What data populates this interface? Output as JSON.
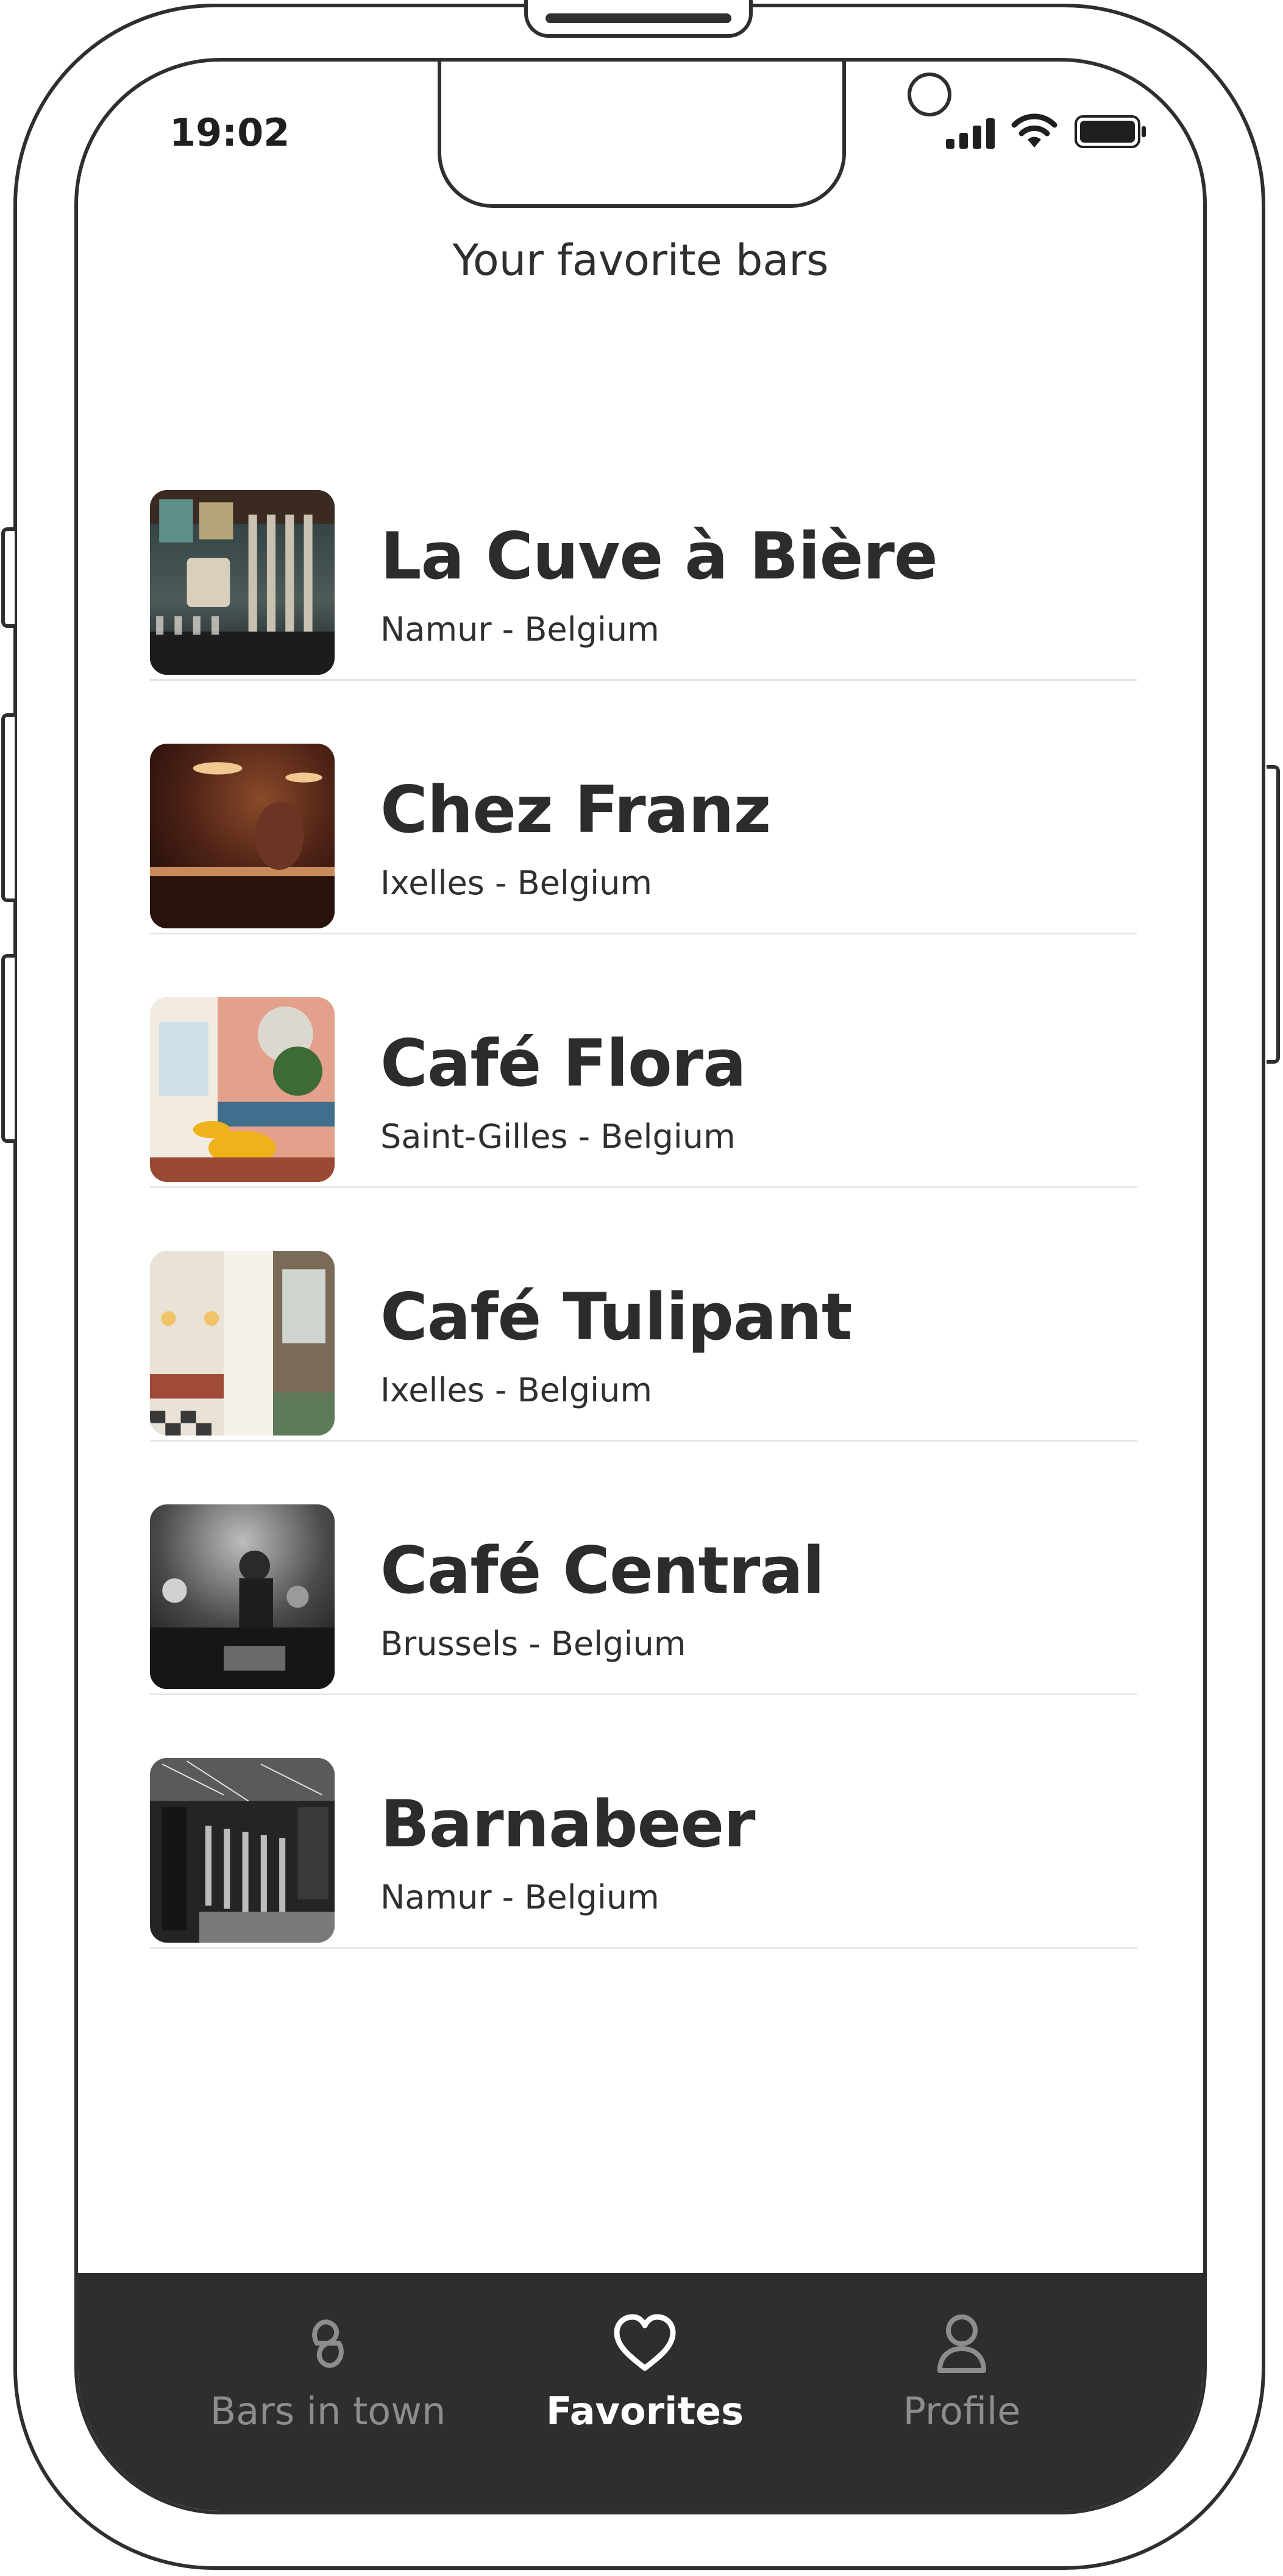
{
  "status_bar": {
    "time": "19:02"
  },
  "page": {
    "title": "Your favorite bars"
  },
  "favorites": [
    {
      "name": "La Cuve à Bière",
      "location": "Namur - Belgium"
    },
    {
      "name": "Chez Franz",
      "location": "Ixelles - Belgium"
    },
    {
      "name": "Café Flora",
      "location": "Saint-Gilles - Belgium"
    },
    {
      "name": "Café Tulipant",
      "location": "Ixelles - Belgium"
    },
    {
      "name": "Café Central",
      "location": "Brussels - Belgium"
    },
    {
      "name": "Barnabeer",
      "location": "Namur - Belgium"
    }
  ],
  "tabbar": {
    "tabs": [
      {
        "label": "Bars in town",
        "icon": "bars-logo-icon"
      },
      {
        "label": "Favorites",
        "icon": "heart-icon",
        "active": true
      },
      {
        "label": "Profile",
        "icon": "profile-icon"
      }
    ]
  },
  "colors": {
    "text": "#2f2f2f",
    "tabbar_bg": "#2e2e2e",
    "tab_active": "#ffffff",
    "tab_inactive": "#8d8d8d"
  }
}
